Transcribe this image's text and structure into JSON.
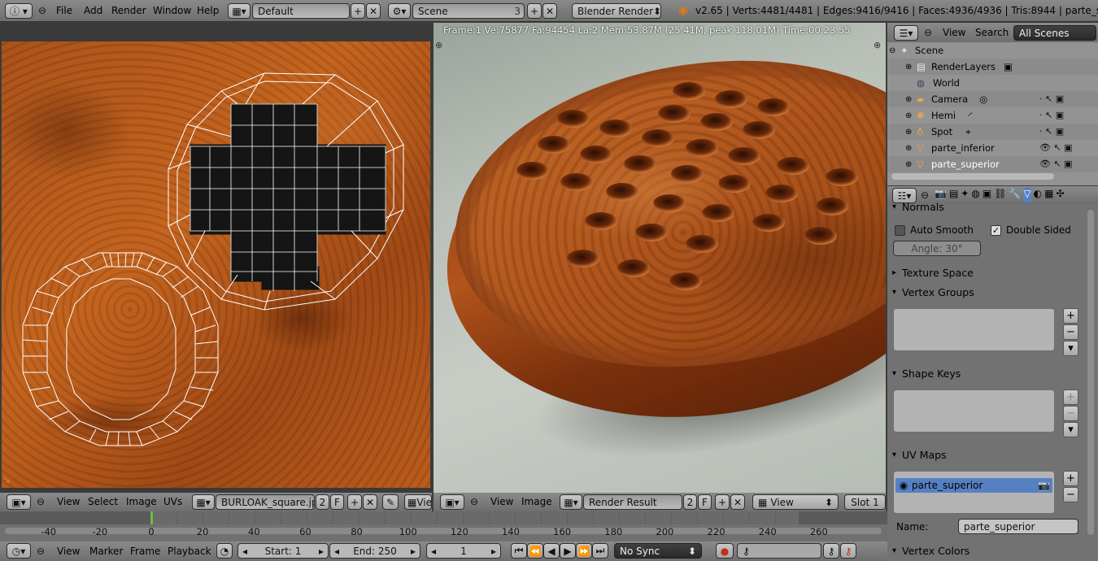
{
  "topbar": {
    "menus": [
      "File",
      "Add",
      "Render",
      "Window",
      "Help"
    ],
    "layout": "Default",
    "scene": "Scene",
    "scene_users": "3",
    "engine": "Blender Render",
    "stats": "v2.65 | Verts:4481/4481 | Edges:9416/9416 | Faces:4936/4936 | Tris:8944 | parte_superior"
  },
  "render_view": {
    "info": "Frame:1 Ve:75877 Fa:94454 La:2 Mem:53.87M (25.41M, peak 118.01M) Time:00:23.55"
  },
  "uv_header": {
    "menus": [
      "View",
      "Select",
      "Image",
      "UVs"
    ],
    "image_name": "BURLOAK_square.jpg",
    "users": "2",
    "fake": "F",
    "truncated": "Vie"
  },
  "image_header": {
    "menus": [
      "View",
      "Image"
    ],
    "image_name": "Render Result",
    "users": "2",
    "fake": "F",
    "view": "View",
    "slot": "Slot 1"
  },
  "outliner": {
    "menus": [
      "View",
      "Search"
    ],
    "filter": "All Scenes",
    "items": [
      {
        "label": "Scene",
        "icon": "scene-icon"
      },
      {
        "label": "RenderLayers",
        "icon": "render-layers-icon"
      },
      {
        "label": "World",
        "icon": "world-icon"
      },
      {
        "label": "Camera",
        "icon": "camera-icon"
      },
      {
        "label": "Hemi",
        "icon": "lamp-icon"
      },
      {
        "label": "Spot",
        "icon": "lamp-icon"
      },
      {
        "label": "parte_inferior",
        "icon": "mesh-icon"
      },
      {
        "label": "parte_superior",
        "icon": "mesh-icon"
      }
    ]
  },
  "properties": {
    "normals": "Normals",
    "auto_smooth": "Auto Smooth",
    "double_sided": "Double Sided",
    "angle": "Angle: 30°",
    "texture_space": "Texture Space",
    "vertex_groups": "Vertex Groups",
    "shape_keys": "Shape Keys",
    "uv_maps": "UV Maps",
    "uv_item": "parte_superior",
    "name_label": "Name:",
    "name_value": "parte_superior",
    "vertex_colors": "Vertex Colors"
  },
  "timeline": {
    "ticks": [
      "-40",
      "-20",
      "0",
      "20",
      "40",
      "60",
      "80",
      "100",
      "120",
      "140",
      "160",
      "180",
      "200",
      "220",
      "240",
      "260"
    ],
    "menus": [
      "View",
      "Marker",
      "Frame",
      "Playback"
    ],
    "start": "Start: 1",
    "end": "End: 250",
    "current": "1",
    "sync": "No Sync"
  },
  "colors": {
    "header_grey": "#7c7c7c",
    "selection_blue": "#5680c2",
    "wood_dark": "#6e2e0c",
    "wood_light": "#c0621f",
    "frame_marker": "#63c33a"
  }
}
